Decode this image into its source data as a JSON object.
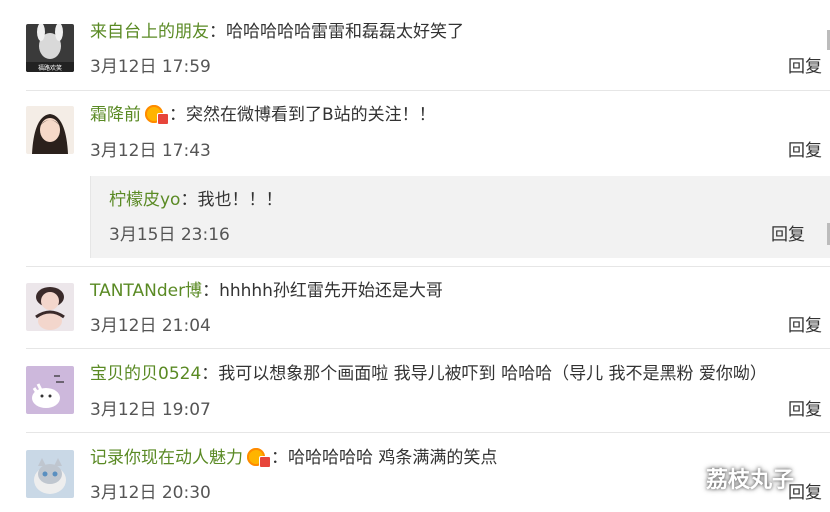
{
  "comments": [
    {
      "user": "来自台上的朋友",
      "text": "哈哈哈哈哈雷雷和磊磊太好笑了",
      "date": "3月12日 17:59",
      "reply_label": "回复",
      "has_vip": false
    },
    {
      "user": "霜降前",
      "text": "突然在微博看到了B站的关注！！",
      "date": "3月12日 17:43",
      "reply_label": "回复",
      "has_vip": true,
      "subreply": {
        "user": "柠檬皮yo",
        "text": "我也！！！",
        "date": "3月15日 23:16",
        "reply_label": "回复"
      }
    },
    {
      "user": "TANTANder博",
      "text": "hhhhh孙红雷先开始还是大哥",
      "date": "3月12日 21:04",
      "reply_label": "回复",
      "has_vip": false
    },
    {
      "user": "宝贝的贝0524",
      "text": "我可以想象那个画面啦 我导儿被吓到 哈哈哈（导儿 我不是黑粉 爱你呦）",
      "date": "3月12日 19:07",
      "reply_label": "回复",
      "has_vip": false
    },
    {
      "user": "记录你现在动人魅力",
      "text": "哈哈哈哈哈 鸡条满满的笑点",
      "date": "3月12日 20:30",
      "reply_label": "回复",
      "has_vip": true
    }
  ],
  "avatar_caption_1": "福路欢笑",
  "watermark": "荔枝丸子",
  "colon": "："
}
